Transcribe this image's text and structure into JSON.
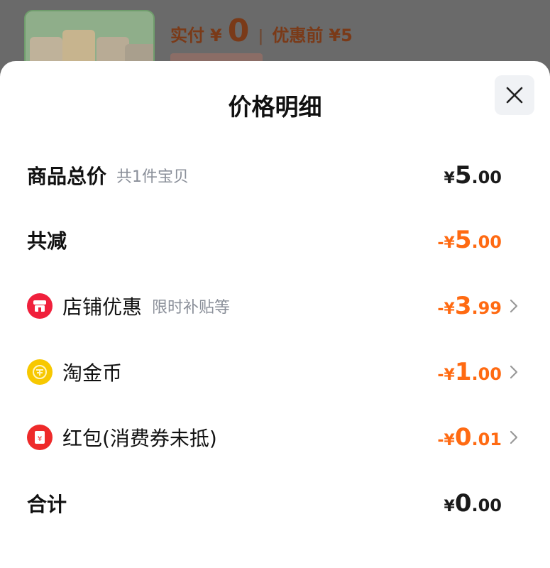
{
  "background": {
    "paid_label": "实付",
    "paid_symbol": "¥",
    "paid_value": "0",
    "separator": "|",
    "original_label": "优惠前",
    "original_value": "¥5"
  },
  "sheet": {
    "title": "价格明细",
    "rows": [
      {
        "label": "商品总价",
        "sub": "共1件宝贝",
        "sign_sym": "¥",
        "int": "5",
        "dec": ".00",
        "color": "dark"
      },
      {
        "label": "共减",
        "sign_sym": "-¥",
        "int": "5",
        "dec": ".00",
        "color": "orange"
      },
      {
        "label": "店铺优惠",
        "sub": "限时补贴等",
        "sign_sym": "-¥",
        "int": "3",
        "dec": ".99",
        "color": "orange",
        "icon": "shop-icon"
      },
      {
        "label": "淘金币",
        "sign_sym": "-¥",
        "int": "1",
        "dec": ".00",
        "color": "orange",
        "icon": "coin-icon"
      },
      {
        "label": "红包(消费券未抵)",
        "sign_sym": "-¥",
        "int": "0",
        "dec": ".01",
        "color": "orange",
        "icon": "red-packet-icon"
      },
      {
        "label": "合计",
        "sign_sym": "¥",
        "int": "0",
        "dec": ".00",
        "color": "dark"
      }
    ]
  },
  "colors": {
    "orange": "#ff6a12",
    "shop_icon": "#f0203c",
    "coin_icon": "#f7c800",
    "red_packet_icon": "#ee2a2a"
  }
}
